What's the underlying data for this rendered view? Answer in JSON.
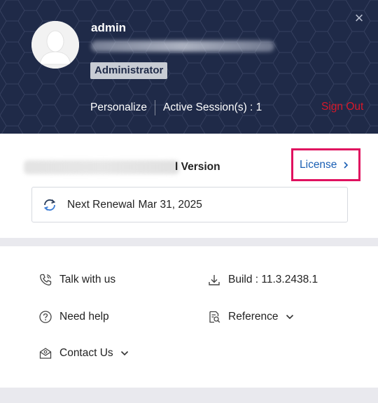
{
  "header": {
    "close_glyph": "×",
    "username": "admin",
    "role": "Administrator",
    "links": [
      "Personalize",
      "Active Session(s) : 1"
    ],
    "sign_out": "Sign Out"
  },
  "license": {
    "version_suffix": "l Version",
    "link_label": "License",
    "renewal_label": "Next Renewal",
    "renewal_date": "Mar 31, 2025"
  },
  "support": {
    "talk": "Talk with us",
    "build": "Build : 11.3.2438.1",
    "help": "Need help",
    "reference": "Reference",
    "contact": "Contact Us"
  },
  "colors": {
    "header_bg": "#1f2a48",
    "sign_out": "#d8182a",
    "link": "#1a5fb4",
    "highlight": "#e0115f"
  }
}
